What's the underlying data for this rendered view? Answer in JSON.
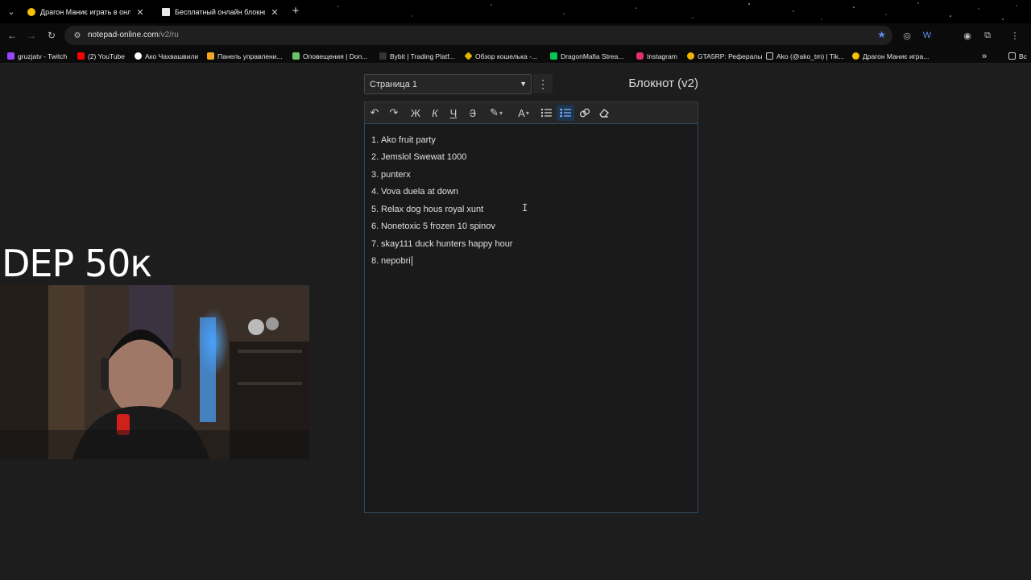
{
  "browser": {
    "tabs": [
      {
        "title": "Драгон Маниє играть в онлайн",
        "close": "✕",
        "favicon_color": "#f2c200"
      },
      {
        "title": "Бесплатный онлайн блокнот",
        "close": "✕",
        "favicon_color": "#e8e8e8"
      }
    ],
    "new_tab": "+",
    "url_host": "notepad-online.com",
    "url_path": "/v2/ru",
    "bookmarks": [
      {
        "label": "gruzjatv - Twitch",
        "color": "#9146ff"
      },
      {
        "label": "(2) YouTube",
        "color": "#ff0000"
      },
      {
        "label": "Ако Чахвашвили",
        "color": "#ffffff"
      },
      {
        "label": "Панель управлени...",
        "color": "#f5a623"
      },
      {
        "label": "Оповещения | Don...",
        "color": "#6ac46a"
      },
      {
        "label": "Bybit | Trading Platf...",
        "color": "#333333"
      },
      {
        "label": "Обзор кошелька -...",
        "color": "#e0b400"
      },
      {
        "label": "DragonMafia Strea...",
        "color": "#00c853"
      },
      {
        "label": "Instagram",
        "color": "#e1306c"
      },
      {
        "label": "GTA5RP: Рефералы",
        "color": "#f5b300"
      },
      {
        "label": "Ako (@ako_tm) | Tik...",
        "color": "#111111"
      },
      {
        "label": "Драгон Маниє игра...",
        "color": "#f2c200"
      }
    ],
    "bookmarks_more": "»",
    "all_bookmarks": "Вс"
  },
  "notepad": {
    "page_select": "Страница 1",
    "title": "Блокнот (v2)",
    "toolbar": {
      "undo": "↶",
      "redo": "↷",
      "bold": "Ж",
      "italic": "К",
      "underline": "Ч",
      "strike": "З",
      "highlight": "🖌",
      "font_color": "A",
      "bullet_list": "☰",
      "numbered_list": "☷",
      "link": "🔗",
      "clear": "⌫"
    },
    "items": [
      {
        "num": "1.",
        "text": "Ako fruit party"
      },
      {
        "num": "2.",
        "text": "Jemslol Swewat 1000"
      },
      {
        "num": "3.",
        "text": "punterx"
      },
      {
        "num": "4.",
        "text": "Vova duela at down"
      },
      {
        "num": "5.",
        "text": "Relax dog hous royal xunt"
      },
      {
        "num": "6.",
        "text": "Nonetoxic 5 frozen 10 spinov"
      },
      {
        "num": "7.",
        "text": "skay111 duck hunters happy hour"
      },
      {
        "num": "8.",
        "text": "nepobri"
      }
    ]
  },
  "overlay": {
    "text": "DEP 50к"
  }
}
